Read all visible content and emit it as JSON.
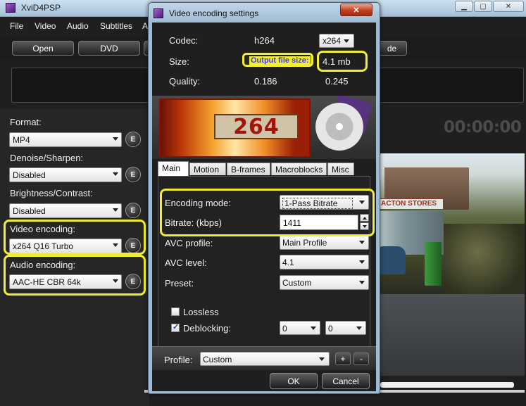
{
  "main": {
    "title": "XviD4PSP",
    "menu": [
      "File",
      "Video",
      "Audio",
      "Subtitles",
      "A"
    ],
    "toolbar": [
      "Open",
      "DVD",
      "",
      "de"
    ],
    "timer": "00:00:00",
    "panel": [
      {
        "label": "Format:",
        "value": "MP4"
      },
      {
        "label": "Denoise/Sharpen:",
        "value": "Disabled"
      },
      {
        "label": "Brightness/Contrast:",
        "value": "Disabled"
      },
      {
        "label": "Video encoding:",
        "value": "x264 Q16 Turbo"
      },
      {
        "label": "Audio encoding:",
        "value": "AAC-HE CBR 64k"
      }
    ],
    "e_button": "E",
    "preview_sign": "ACTON STORES"
  },
  "dialog": {
    "title": "Video encoding settings",
    "codec_label": "Codec:",
    "codec_value": "h264",
    "codec_select": "x264",
    "size_label": "Size:",
    "output_file_size_label": "Output file size:",
    "size_value": "4.1 mb",
    "quality_label": "Quality:",
    "quality_value1": "0.186",
    "quality_value2": "0.245",
    "banner_text": "264",
    "tabs": [
      "Main",
      "Motion",
      "B-frames",
      "Macroblocks",
      "Misc"
    ],
    "fields": {
      "encoding_mode_label": "Encoding mode:",
      "encoding_mode_value": "1-Pass Bitrate",
      "bitrate_label": "Bitrate: (kbps)",
      "bitrate_value": "1411",
      "avc_profile_label": "AVC profile:",
      "avc_profile_value": "Main Profile",
      "avc_level_label": "AVC level:",
      "avc_level_value": "4.1",
      "preset_label": "Preset:",
      "preset_value": "Custom",
      "lossless_label": "Lossless",
      "lossless_checked": false,
      "deblocking_label": "Deblocking:",
      "deblocking_checked": true,
      "deblock_a": "0",
      "deblock_b": "0"
    },
    "profile_label": "Profile:",
    "profile_value": "Custom",
    "plus": "+",
    "minus": "-",
    "ok": "OK",
    "cancel": "Cancel"
  },
  "colors": {
    "highlight": "#f3ee34",
    "dialog_bg": "#1f1f1f"
  }
}
